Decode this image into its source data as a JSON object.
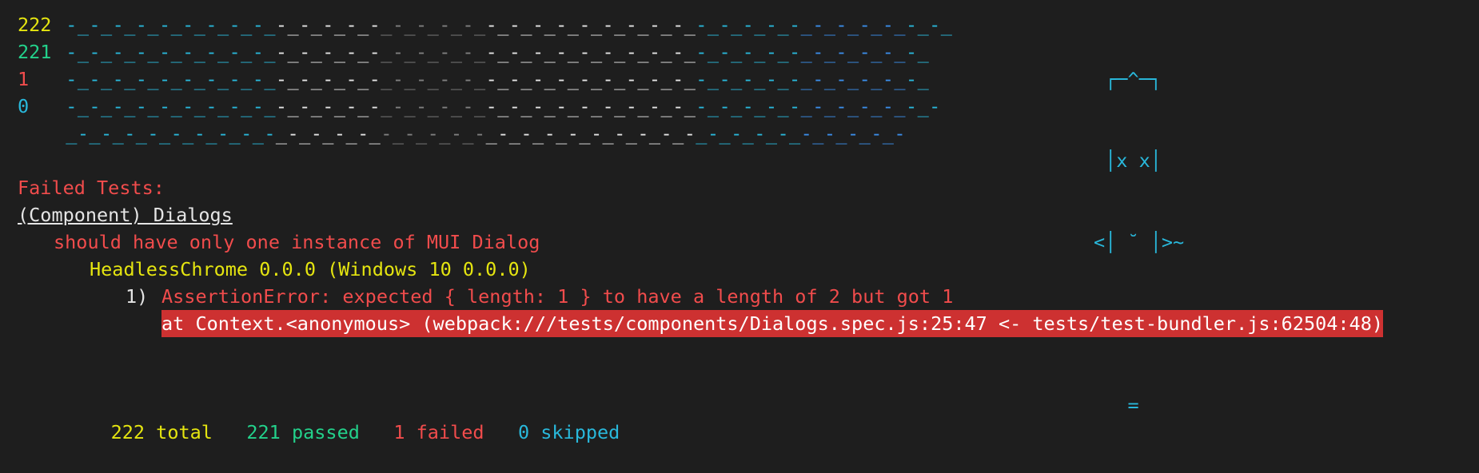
{
  "counters": {
    "total": "222",
    "passed": "221",
    "failed": "1",
    "skipped": "0"
  },
  "trail_patterns": [
    "-_-_-_-_-_-_-_-_-_-_-_-_-_-_-_-_-_-_-_-_-_-_-_-_-_-_-_-_-_-_-_-_-_-_-_-_-_-_",
    "-_-_-_-_-_-_-_-_-_-_-_-_-_-_-_-_-_-_-_-_-_-_-_-_-_-_-_-_-_-_-_-_-_-_-_-_-_",
    "-_-_-_-_-_-_-_-_-_-_-_-_-_-_-_-_-_-_-_-_-_-_-_-_-_-_-_-_-_-_-_-_-_-_-_-_-_",
    "-_-_-_-_-_-_-_-_-_-_-_-_-_-_-_-_-_-_-_-_-_-_-_-_-_-_-_-_-_-_-_-_-_-_-_-_-_-",
    "_-_-_-_-_-_-_-_-_-_-_-_-_-_-_-_-_-_-_-_-_-_-_-_-_-_-_-_-_-_-_-_-_-_-_-_-"
  ],
  "cat_art": [
    " ┌─^─┐",
    " │x x│",
    "<│ ˘ │>~",
    " └───┘",
    "   ="
  ],
  "report": {
    "heading": "Failed Tests:",
    "suite": "(Component) Dialogs",
    "test_name": "should have only one instance of MUI Dialog",
    "browser": "HeadlessChrome 0.0.0 (Windows 10 0.0.0)",
    "error_index": "1)",
    "error_message": "AssertionError: expected { length: 1 } to have a length of 2 but got 1",
    "stack_line": "at Context.<anonymous> (webpack:///tests/components/Dialogs.spec.js:25:47 <- tests/test-bundler.js:62504:48)"
  },
  "summary": {
    "total_label": "222 total",
    "passed_label": "221 passed",
    "failed_label": "1 failed",
    "skipped_label": "0 skipped"
  },
  "colors": {
    "background": "#1e1e1e",
    "yellow": "#e5e510",
    "green": "#23d18b",
    "red": "#f14c4c",
    "cyan": "#29b8db",
    "highlight": "#cd3131"
  }
}
